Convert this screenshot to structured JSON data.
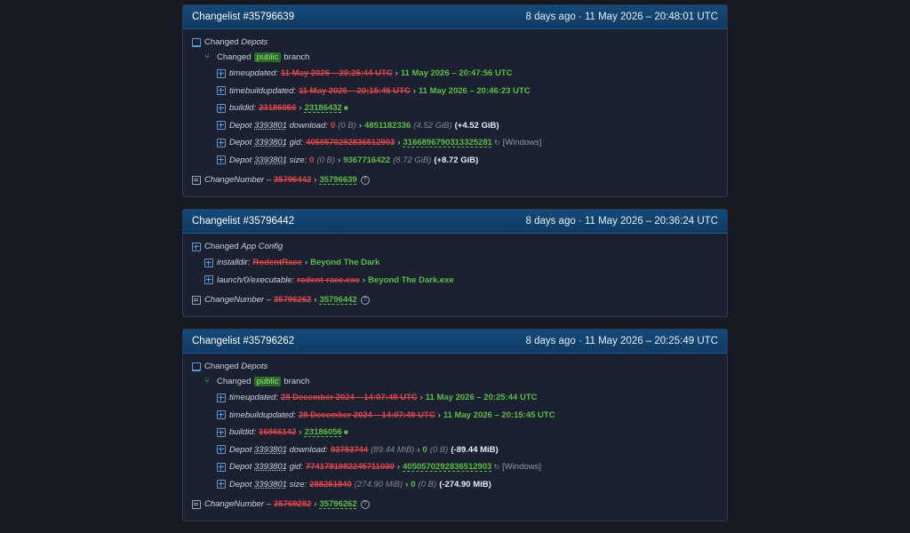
{
  "cards": [
    {
      "title": "Changelist #35796639",
      "date": "8 days ago · 11 May 2026 – 20:48:01 UTC",
      "section": {
        "prefix": "Changed",
        "type": "Depots"
      },
      "branch": {
        "prefix": "Changed",
        "name": "public",
        "suffix": "branch"
      },
      "rows": [
        {
          "key": "timeupdated:",
          "old": "11 May 2026 – 20:25:44 UTC",
          "new": "11 May 2026 – 20:47:56 UTC"
        },
        {
          "key": "timebuildupdated:",
          "old": "11 May 2026 – 20:15:45 UTC",
          "new": "11 May 2026 – 20:46:23 UTC"
        },
        {
          "key": "buildid:",
          "old": "23186056",
          "new": "23186432",
          "icon": "comment-icon"
        },
        {
          "key_pre": "Depot",
          "depot": "3393801",
          "key_post": "download:",
          "old_plain": "0",
          "old_paren": "(0 B)",
          "new": "4851182336",
          "new_paren": "(4.52 GiB)",
          "delta": "(+4.52 GiB)"
        },
        {
          "key_pre": "Depot",
          "depot": "3393801",
          "key_post": "gid:",
          "old": "4050570292836512903",
          "new": "3166896790313325281",
          "platform": "[Windows]"
        },
        {
          "key_pre": "Depot",
          "depot": "3393801",
          "key_post": "size:",
          "old_plain": "0",
          "old_paren": "(0 B)",
          "new": "9367716422",
          "new_paren": "(8.72 GiB)",
          "delta": "(+8.72 GiB)"
        }
      ],
      "change": {
        "key": "ChangeNumber –",
        "old": "35796442",
        "new": "35796639"
      }
    },
    {
      "title": "Changelist #35796442",
      "date": "8 days ago · 11 May 2026 – 20:36:24 UTC",
      "section": {
        "prefix": "Changed",
        "type": "App Config"
      },
      "rows": [
        {
          "key": "installdir:",
          "old": "RodentRace",
          "new": "Beyond The Dark"
        },
        {
          "key": "launch/0/executable:",
          "old": "rodent-race.exe",
          "new": "Beyond The Dark.exe"
        }
      ],
      "change": {
        "key": "ChangeNumber –",
        "old": "35796262",
        "new": "35796442"
      }
    },
    {
      "title": "Changelist #35796262",
      "date": "8 days ago · 11 May 2026 – 20:25:49 UTC",
      "section": {
        "prefix": "Changed",
        "type": "Depots"
      },
      "branch": {
        "prefix": "Changed",
        "name": "public",
        "suffix": "branch"
      },
      "rows": [
        {
          "key": "timeupdated:",
          "old": "28 December 2024 – 14:07:49 UTC",
          "new": "11 May 2026 – 20:25:44 UTC"
        },
        {
          "key": "timebuildupdated:",
          "old": "28 December 2024 – 14:07:49 UTC",
          "new": "11 May 2026 – 20:15:45 UTC"
        },
        {
          "key": "buildid:",
          "old": "16866142",
          "new": "23186056",
          "icon": "comment-icon"
        },
        {
          "key_pre": "Depot",
          "depot": "3393801",
          "key_post": "download:",
          "old": "93783744",
          "old_paren": "(89.44 MiB)",
          "new": "0",
          "new_paren": "(0 B)",
          "delta": "(-89.44 MiB)"
        },
        {
          "key_pre": "Depot",
          "depot": "3393801",
          "key_post": "gid:",
          "old": "7741781982245711030",
          "new": "4050570292836512903",
          "platform": "[Windows]"
        },
        {
          "key_pre": "Depot",
          "depot": "3393801",
          "key_post": "size:",
          "old": "288251840",
          "old_paren": "(274.90 MiB)",
          "new": "0",
          "new_paren": "(0 B)",
          "delta": "(-274.90 MiB)"
        }
      ],
      "change": {
        "key": "ChangeNumber –",
        "old": "35769282",
        "new": "35796262"
      }
    }
  ],
  "colors": {
    "added": "#59bf40",
    "removed": "#e0454a",
    "header": "#134a7a",
    "background": "#171a21"
  }
}
